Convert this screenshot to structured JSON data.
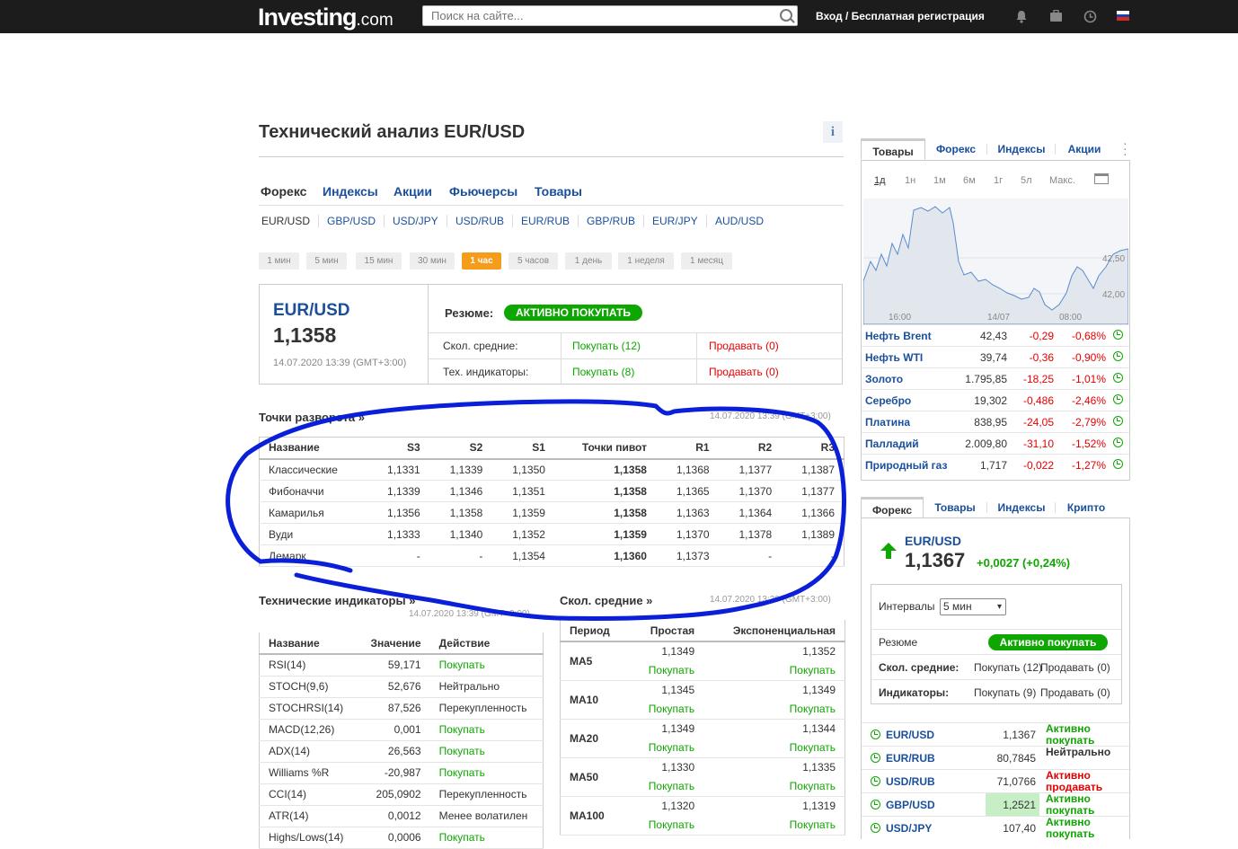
{
  "header": {
    "logo_main": "Investing",
    "logo_suffix": ".com",
    "search_placeholder": "Поиск на сайте...",
    "login": "Вход / Бесплатная регистрация",
    "icons": [
      "bell-icon",
      "briefcase-icon",
      "clock-icon",
      "ru-flag-icon"
    ]
  },
  "page": {
    "title": "Технический анализ EUR/USD",
    "info_label": "i",
    "categories": [
      "Форекс",
      "Индексы",
      "Акции",
      "Фьючерсы",
      "Товары"
    ],
    "active_category": "Форекс",
    "pairs": [
      "EUR/USD",
      "GBP/USD",
      "USD/JPY",
      "USD/RUB",
      "EUR/RUB",
      "GBP/RUB",
      "EUR/JPY",
      "AUD/USD"
    ],
    "active_pair": "EUR/USD",
    "timeframes": [
      "1 мин",
      "5 мин",
      "15 мин",
      "30 мин",
      "1 час",
      "5 часов",
      "1 день",
      "1 неделя",
      "1 месяц"
    ],
    "active_timeframe": "1 час"
  },
  "summary": {
    "symbol": "EUR/USD",
    "price": "1,1358",
    "datetime": "14.07.2020 13:39 (GMT+3:00)",
    "resume_label": "Резюме:",
    "resume_value": "АКТИВНО ПОКУПАТЬ",
    "ma_label": "Скол. средние:",
    "ma_buy": "Покупать (12)",
    "ma_sell": "Продавать (0)",
    "ind_label": "Тех. индикаторы:",
    "ind_buy": "Покупать (8)",
    "ind_sell": "Продавать (0)"
  },
  "pivot": {
    "title": "Точки разворота »",
    "date": "14.07.2020 13:39 (GMT+3:00)",
    "headers": [
      "Название",
      "S3",
      "S2",
      "S1",
      "Точки пивот",
      "R1",
      "R2",
      "R3"
    ],
    "rows": [
      [
        "Классические",
        "1,1331",
        "1,1339",
        "1,1350",
        "1,1358",
        "1,1368",
        "1,1377",
        "1,1387"
      ],
      [
        "Фибоначчи",
        "1,1339",
        "1,1346",
        "1,1351",
        "1,1358",
        "1,1365",
        "1,1370",
        "1,1377"
      ],
      [
        "Камарилья",
        "1,1356",
        "1,1358",
        "1,1359",
        "1,1358",
        "1,1363",
        "1,1364",
        "1,1366"
      ],
      [
        "Вуди",
        "1,1333",
        "1,1340",
        "1,1352",
        "1,1359",
        "1,1370",
        "1,1378",
        "1,1389"
      ],
      [
        "Демарк",
        "-",
        "-",
        "1,1354",
        "1,1360",
        "1,1373",
        "-",
        "-"
      ]
    ]
  },
  "indicators": {
    "title": "Технические индикаторы »",
    "date": "14.07.2020 13:39 (GMT+3:00)",
    "headers": [
      "Название",
      "Значение",
      "Действие"
    ],
    "rows": [
      [
        "RSI(14)",
        "59,171",
        "Покупать"
      ],
      [
        "STOCH(9,6)",
        "52,676",
        "Нейтрально"
      ],
      [
        "STOCHRSI(14)",
        "87,526",
        "Перекупленность"
      ],
      [
        "MACD(12,26)",
        "0,001",
        "Покупать"
      ],
      [
        "ADX(14)",
        "26,563",
        "Покупать"
      ],
      [
        "Williams %R",
        "-20,987",
        "Покупать"
      ],
      [
        "CCI(14)",
        "205,0902",
        "Перекупленность"
      ],
      [
        "ATR(14)",
        "0,0012",
        "Менее волатилен"
      ],
      [
        "Highs/Lows(14)",
        "0,0006",
        "Покупать"
      ]
    ]
  },
  "moving_averages": {
    "title": "Скол. средние »",
    "date": "14.07.2020 13:39 (GMT+3:00)",
    "headers": [
      "Период",
      "Простая",
      "Экспоненциальная"
    ],
    "rows": [
      [
        "MA5",
        "1,1349",
        "Покупать",
        "1,1352",
        "Покупать"
      ],
      [
        "MA10",
        "1,1345",
        "Покупать",
        "1,1349",
        "Покупать"
      ],
      [
        "MA20",
        "1,1349",
        "Покупать",
        "1,1344",
        "Покупать"
      ],
      [
        "MA50",
        "1,1330",
        "Покупать",
        "1,1335",
        "Покупать"
      ],
      [
        "MA100",
        "1,1320",
        "Покупать",
        "1,1319",
        "Покупать"
      ]
    ]
  },
  "commodities": {
    "tabs": [
      "Товары",
      "Форекс",
      "Индексы",
      "Акции"
    ],
    "periods": [
      "1д",
      "1н",
      "1м",
      "6м",
      "1г",
      "5л",
      "Макс."
    ],
    "chart_labels": {
      "y": [
        "42,50",
        "42,00"
      ],
      "x": [
        "16:00",
        "14/07",
        "08:00"
      ]
    },
    "rows": [
      [
        "Нефть Brent",
        "42,43",
        "-0,29",
        "-0,68%"
      ],
      [
        "Нефть WTI",
        "39,74",
        "-0,36",
        "-0,90%"
      ],
      [
        "Золото",
        "1.795,85",
        "-18,25",
        "-1,01%"
      ],
      [
        "Серебро",
        "19,302",
        "-0,486",
        "-2,46%"
      ],
      [
        "Платина",
        "838,95",
        "-24,05",
        "-2,79%"
      ],
      [
        "Палладий",
        "2.009,80",
        "-31,10",
        "-1,52%"
      ],
      [
        "Природный газ",
        "1,717",
        "-0,022",
        "-1,27%"
      ]
    ]
  },
  "forex_widget": {
    "tabs": [
      "Форекс",
      "Товары",
      "Индексы",
      "Крипто"
    ],
    "symbol": "EUR/USD",
    "price": "1,1367",
    "change": "+0,0027 (+0,24%)",
    "interval_label": "Интервалы",
    "interval_value": "5 мин",
    "resume_label": "Резюме",
    "resume_value": "Активно покупать",
    "ma_label": "Скол. средние:",
    "ma_buy": "Покупать (12)",
    "ma_sell": "Продавать (0)",
    "ind_label": "Индикаторы:",
    "ind_buy": "Покупать (9)",
    "ind_sell": "Продавать (0)",
    "quotes": [
      [
        "EUR/USD",
        "1,1367",
        "Активно покупать"
      ],
      [
        "EUR/RUB",
        "80,7845",
        "Нейтрально"
      ],
      [
        "USD/RUB",
        "71,0766",
        "Активно продавать"
      ],
      [
        "GBP/USD",
        "1,2521",
        "Активно покупать"
      ],
      [
        "USD/JPY",
        "107,40",
        "Активно покупать"
      ]
    ]
  },
  "colors": {
    "buy": "#0ea600",
    "sell": "#e60000",
    "link": "#1a4f9c",
    "annotation": "#0a1fd8"
  }
}
